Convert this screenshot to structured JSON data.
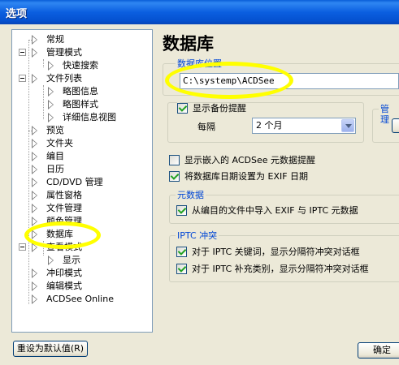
{
  "window": {
    "title": "选项"
  },
  "tree": {
    "items": [
      {
        "label": "常规"
      },
      {
        "label": "管理模式"
      },
      {
        "label": "快速搜索"
      },
      {
        "label": "文件列表"
      },
      {
        "label": "略图信息"
      },
      {
        "label": "略图样式"
      },
      {
        "label": "详细信息视图"
      },
      {
        "label": "预览"
      },
      {
        "label": "文件夹"
      },
      {
        "label": "编目"
      },
      {
        "label": "日历"
      },
      {
        "label": "CD/DVD 管理"
      },
      {
        "label": "属性窗格"
      },
      {
        "label": "文件管理"
      },
      {
        "label": "颜色管理"
      },
      {
        "label": "数据库"
      },
      {
        "label": "查看模式"
      },
      {
        "label": "显示"
      },
      {
        "label": "冲印模式"
      },
      {
        "label": "编辑模式"
      },
      {
        "label": "ACDSee Online"
      }
    ]
  },
  "footer": {
    "reset_label": "重设为默认值(R)",
    "ok_label": "确定"
  },
  "panel": {
    "heading": "数据库",
    "location": {
      "legend": "数据库位置",
      "path": "C:\\systemp\\ACDSee"
    },
    "backup": {
      "show_reminder_label": "显示备份提醒",
      "show_reminder_checked": true,
      "interval_label": "每隔",
      "interval_value": "2 个月"
    },
    "manage_legend": "管理",
    "options": [
      {
        "label": "显示嵌入的 ACDSee 元数据提醒",
        "checked": false
      },
      {
        "label": "将数据库日期设置为 EXIF 日期",
        "checked": true
      }
    ],
    "metadata": {
      "legend": "元数据",
      "import_label": "从编目的文件中导入 EXIF 与 IPTC 元数据",
      "import_checked": true
    },
    "iptc": {
      "legend": "IPTC 冲突",
      "keyword_label": "对于 IPTC 关键词，显示分隔符冲突对话框",
      "keyword_checked": true,
      "category_label": "对于 IPTC 补充类别，显示分隔符冲突对话框",
      "category_checked": true
    }
  },
  "colors": {
    "title_bar": "#0a5fd8",
    "highlight": "#ffff00",
    "legend_text": "#0046d5"
  }
}
